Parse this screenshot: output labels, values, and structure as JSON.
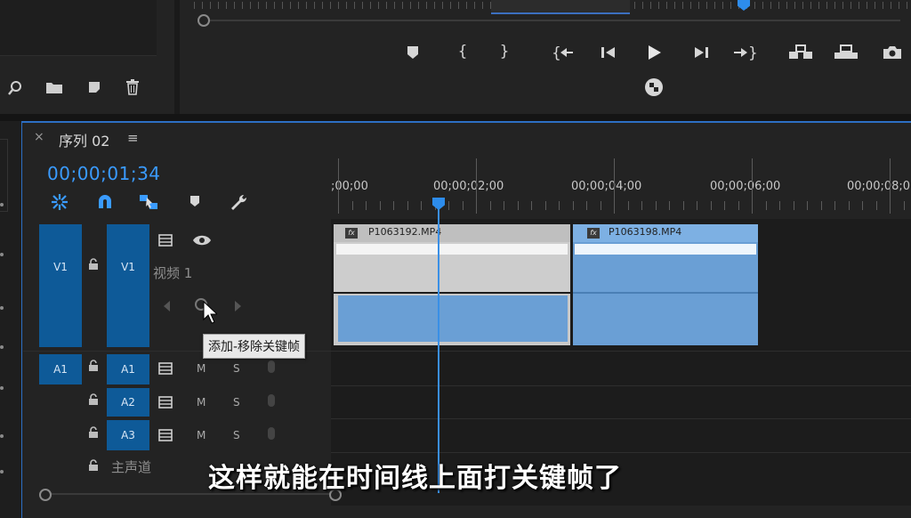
{
  "top_panel": {
    "transport_icons": [
      "marker-icon",
      "mark-in-icon",
      "mark-out-icon",
      "go-to-in-icon",
      "step-back-icon",
      "play-icon",
      "step-forward-icon",
      "go-to-out-icon",
      "insert-icon",
      "overwrite-icon",
      "export-frame-icon"
    ],
    "button_editor_icon": "button-editor-icon",
    "project_icons": [
      "search-icon",
      "folder-icon",
      "new-item-icon",
      "trash-icon"
    ]
  },
  "sequence": {
    "close_label": "×",
    "title": "序列 02",
    "menu_label": "≡",
    "timecode": "00;00;01;34"
  },
  "ruler": {
    "labels": [
      ";00;00",
      "00;00;02;00",
      "00;00;04;00",
      "00;00;06;00",
      "00;00;08;0"
    ]
  },
  "tracks": {
    "video": {
      "source": "V1",
      "target": "V1",
      "name": "视频 1"
    },
    "audio": [
      {
        "source": "A1",
        "target": "A1",
        "m": "M",
        "s": "S"
      },
      {
        "source": "",
        "target": "A2",
        "m": "M",
        "s": "S"
      },
      {
        "source": "",
        "target": "A3",
        "m": "M",
        "s": "S"
      }
    ],
    "master": "主声道"
  },
  "clips": [
    {
      "name": "P1063192.MP4",
      "fx": "fx"
    },
    {
      "name": "P1063198.MP4",
      "fx": "fx"
    }
  ],
  "tooltip": "添加-移除关键帧",
  "caption": "这样就能在时间线上面打关键帧了",
  "colors": {
    "accent": "#3a9bff",
    "track_blue": "#0e5a98",
    "clip_blue": "#6a9fd5",
    "clip_gray": "#cdcdcd"
  }
}
